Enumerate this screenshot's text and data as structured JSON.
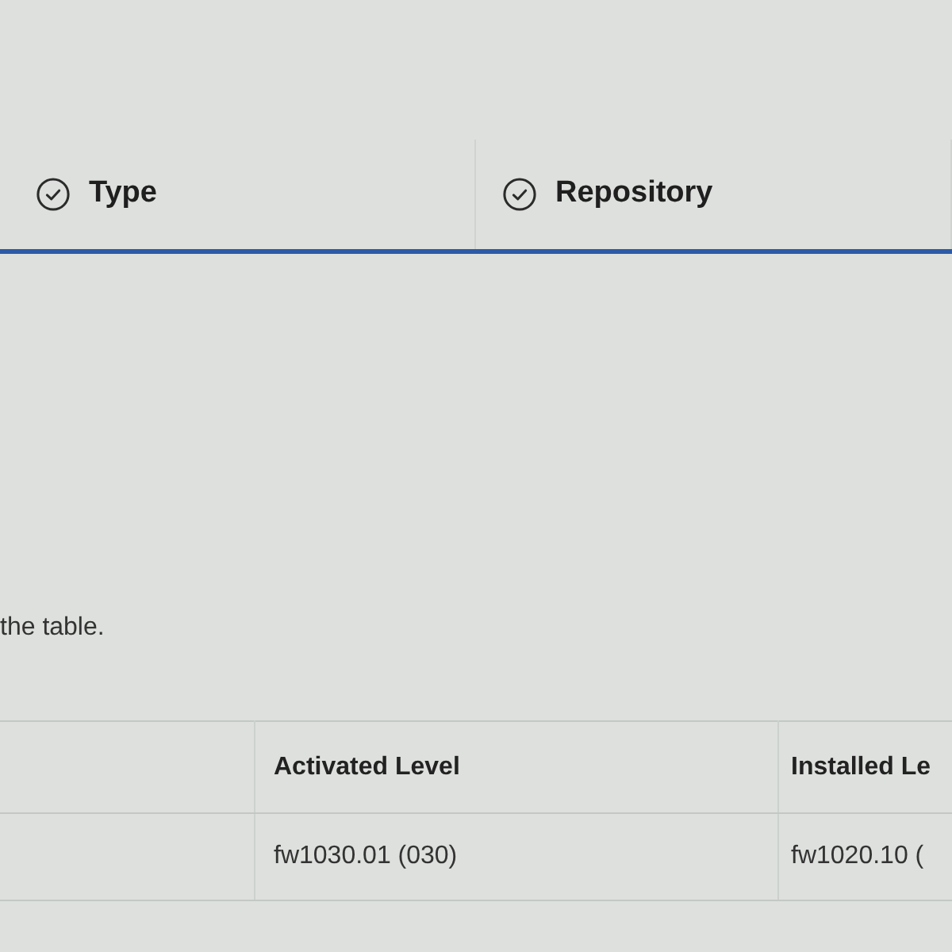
{
  "filter_header": {
    "columns": [
      {
        "label": "Type"
      },
      {
        "label": "Repository"
      }
    ]
  },
  "note": "the table.",
  "table": {
    "columns": [
      {
        "label": "Activated Level"
      },
      {
        "label": "Installed Le"
      }
    ],
    "rows": [
      {
        "cells": [
          "fw1030.01 (030)",
          "fw1020.10 ("
        ]
      }
    ]
  }
}
